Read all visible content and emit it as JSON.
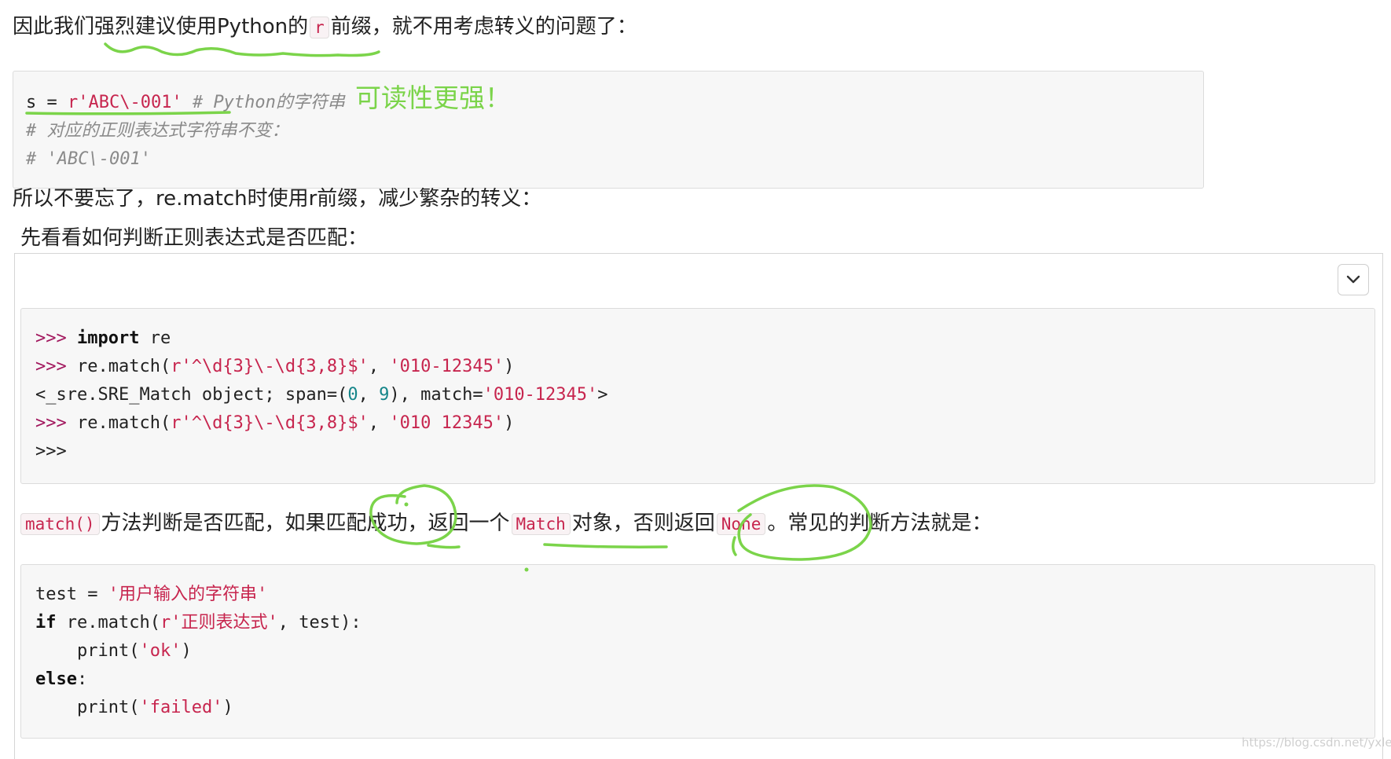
{
  "intro_paragraph": {
    "before": "因此我们强烈建议使用Python的",
    "code": "r",
    "after": "前缀，就不用考虑转义的问题了："
  },
  "code_block_1": {
    "line1": {
      "var": "s",
      "op": " = ",
      "value": "r'ABC\\-001'",
      "comment": " # Python的字符串"
    },
    "line2": "# 对应的正则表达式字符串不变：",
    "line3": "# 'ABC\\-001'"
  },
  "handwritten_note": "可读性更强！",
  "reminder_paragraph": "所以不要忘了，re.match时使用r前缀，减少繁杂的转义：",
  "panel_heading": "先看看如何判断正则表达式是否匹配：",
  "collapse_toggle": {
    "icon": "chevron-down-icon"
  },
  "code_block_2": {
    "l1": {
      "prompt": ">>>",
      "kw": "import",
      "rest": " re"
    },
    "l2": {
      "prompt": ">>>",
      "call": " re.match(",
      "pattern": "r'^\\d{3}\\-\\d{3,8}$'",
      "comma": ", ",
      "arg": "'010-12345'",
      "close": ")"
    },
    "l3": {
      "a": "<_sre.SRE_Match object; span=(",
      "n1": "0",
      "b": ", ",
      "n2": "9",
      "c": "), match=",
      "m": "'010-12345'",
      "d": ">"
    },
    "l4": {
      "prompt": ">>>",
      "call": " re.match(",
      "pattern": "r'^\\d{3}\\-\\d{3,8}$'",
      "comma": ", ",
      "arg": "'010 12345'",
      "close": ")"
    },
    "l5": {
      "prompt": ">>>"
    }
  },
  "explanation_paragraph": {
    "code1": "match()",
    "t1": "方法判断是否匹配，如果匹配成功，返回一个",
    "code2": "Match",
    "t2": "对象，否则返回",
    "code3": "None",
    "t3": "。常见的判断方法就是："
  },
  "code_block_3": {
    "l1": {
      "a": "test = ",
      "s": "'用户输入的字符串'"
    },
    "l2": {
      "kw": "if",
      "a": " re.match(",
      "s": "r'正则表达式'",
      "b": ", test):"
    },
    "l3": {
      "indent": "    ",
      "a": "print(",
      "s": "'ok'",
      "b": ")"
    },
    "l4": {
      "kw": "else",
      "a": ":"
    },
    "l5": {
      "indent": "    ",
      "a": "print(",
      "s": "'failed'",
      "b": ")"
    }
  },
  "watermark": "https://blog.csdn.net/yxlelu",
  "colors": {
    "annotation_green": "#7bd44a",
    "string_red": "#c7254e",
    "prompt_purple": "#a2185e",
    "code_bg": "#f7f7f7"
  }
}
